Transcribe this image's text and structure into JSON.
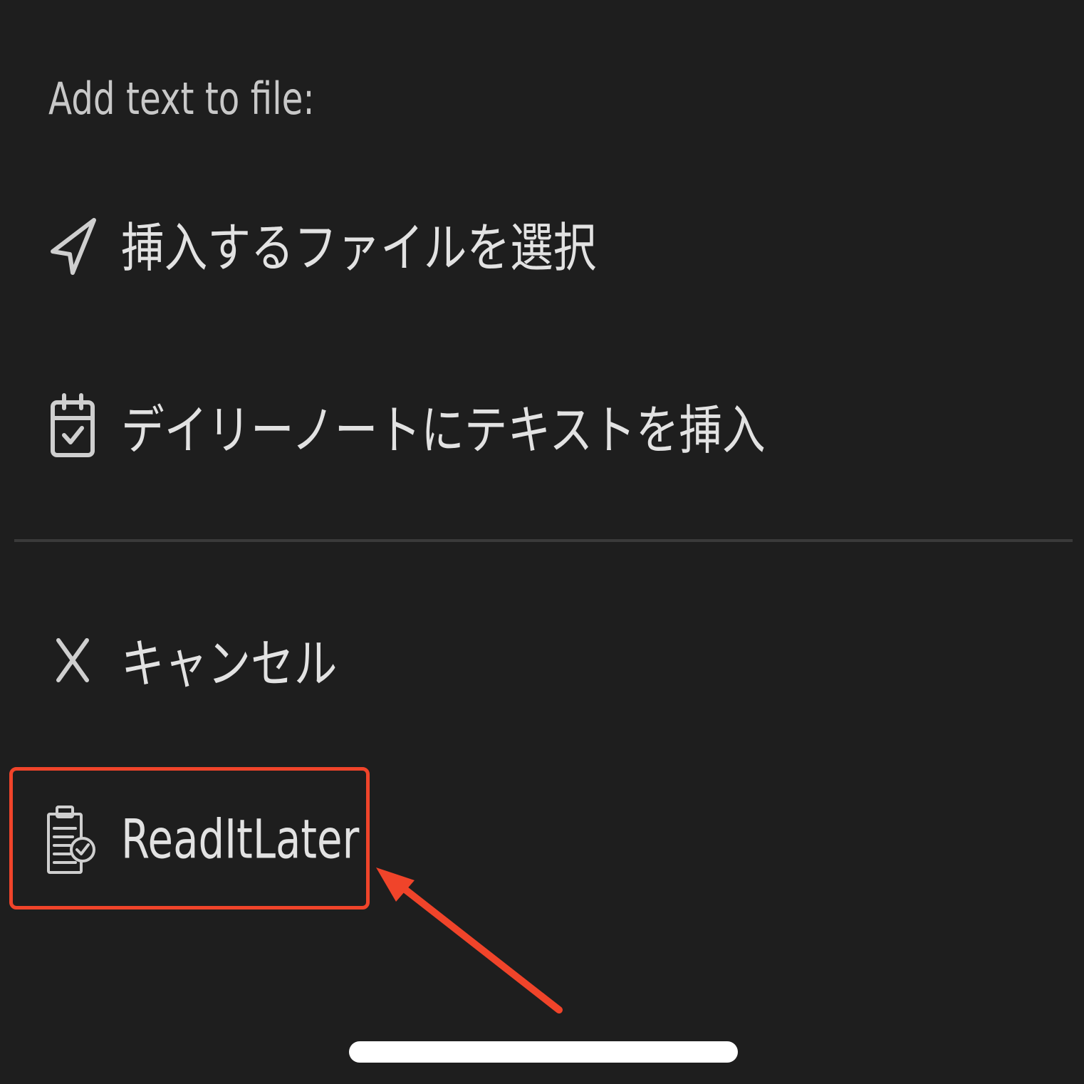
{
  "header": {
    "title": "Add text to file:"
  },
  "menu": {
    "items": [
      {
        "label": "挿入するファイルを選択",
        "icon": "navigation-arrow-icon"
      },
      {
        "label": "デイリーノートにテキストを挿入",
        "icon": "calendar-check-icon"
      },
      {
        "label": "キャンセル",
        "icon": "close-icon"
      },
      {
        "label": "ReadItLater",
        "icon": "clipboard-check-icon"
      }
    ]
  },
  "annotation": {
    "highlight_color": "#f0442a"
  },
  "colors": {
    "background": "#1e1e1e",
    "text": "#e2e2e2",
    "icon": "#cfcfcf",
    "divider": "#3a3a3a"
  }
}
